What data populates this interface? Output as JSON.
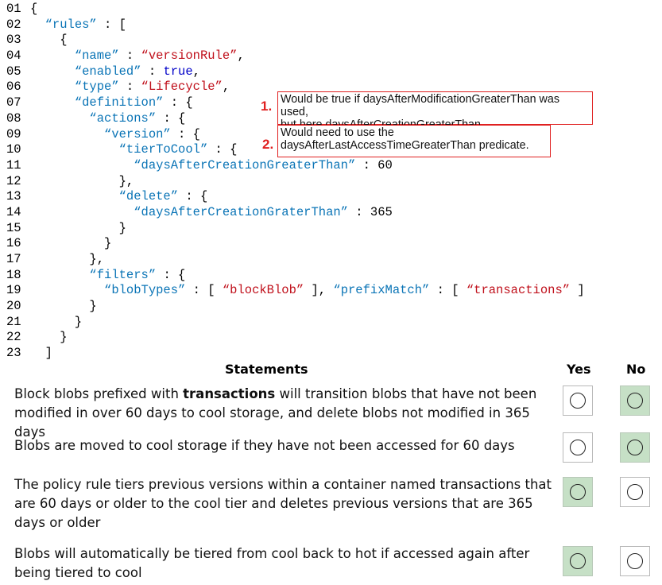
{
  "code_lines": [
    {
      "num": "01",
      "parts": [
        {
          "t": "{",
          "c": "p"
        }
      ]
    },
    {
      "num": "02",
      "parts": [
        {
          "t": "  ",
          "c": "p"
        },
        {
          "t": "“rules”",
          "c": "k"
        },
        {
          "t": " : [",
          "c": "p"
        }
      ]
    },
    {
      "num": "03",
      "parts": [
        {
          "t": "    {",
          "c": "p"
        }
      ]
    },
    {
      "num": "04",
      "parts": [
        {
          "t": "      ",
          "c": "p"
        },
        {
          "t": "“name”",
          "c": "k"
        },
        {
          "t": " : ",
          "c": "p"
        },
        {
          "t": "“versionRule”",
          "c": "s"
        },
        {
          "t": ",",
          "c": "p"
        }
      ]
    },
    {
      "num": "05",
      "parts": [
        {
          "t": "      ",
          "c": "p"
        },
        {
          "t": "“enabled”",
          "c": "k"
        },
        {
          "t": " : ",
          "c": "p"
        },
        {
          "t": "true",
          "c": "kw"
        },
        {
          "t": ",",
          "c": "p"
        }
      ]
    },
    {
      "num": "06",
      "parts": [
        {
          "t": "      ",
          "c": "p"
        },
        {
          "t": "“type”",
          "c": "k"
        },
        {
          "t": " : ",
          "c": "p"
        },
        {
          "t": "“Lifecycle”",
          "c": "s"
        },
        {
          "t": ",",
          "c": "p"
        }
      ]
    },
    {
      "num": "07",
      "parts": [
        {
          "t": "      ",
          "c": "p"
        },
        {
          "t": "“definition”",
          "c": "k"
        },
        {
          "t": " : {",
          "c": "p"
        }
      ]
    },
    {
      "num": "08",
      "parts": [
        {
          "t": "        ",
          "c": "p"
        },
        {
          "t": "“actions”",
          "c": "k"
        },
        {
          "t": " : {",
          "c": "p"
        }
      ]
    },
    {
      "num": "09",
      "parts": [
        {
          "t": "          ",
          "c": "p"
        },
        {
          "t": "“version”",
          "c": "k"
        },
        {
          "t": " : {",
          "c": "p"
        }
      ]
    },
    {
      "num": "10",
      "parts": [
        {
          "t": "            ",
          "c": "p"
        },
        {
          "t": "“tierToCool”",
          "c": "k"
        },
        {
          "t": " : {",
          "c": "p"
        }
      ]
    },
    {
      "num": "11",
      "parts": [
        {
          "t": "              ",
          "c": "p"
        },
        {
          "t": "“daysAfterCreationGreaterThan”",
          "c": "k"
        },
        {
          "t": " : 60",
          "c": "p"
        }
      ]
    },
    {
      "num": "12",
      "parts": [
        {
          "t": "            },",
          "c": "p"
        }
      ]
    },
    {
      "num": "13",
      "parts": [
        {
          "t": "            ",
          "c": "p"
        },
        {
          "t": "“delete”",
          "c": "k"
        },
        {
          "t": " : {",
          "c": "p"
        }
      ]
    },
    {
      "num": "14",
      "parts": [
        {
          "t": "              ",
          "c": "p"
        },
        {
          "t": "“daysAfterCreationGraterThan”",
          "c": "k"
        },
        {
          "t": " : 365",
          "c": "p"
        }
      ]
    },
    {
      "num": "15",
      "parts": [
        {
          "t": "            }",
          "c": "p"
        }
      ]
    },
    {
      "num": "16",
      "parts": [
        {
          "t": "          }",
          "c": "p"
        }
      ]
    },
    {
      "num": "17",
      "parts": [
        {
          "t": "        },",
          "c": "p"
        }
      ]
    },
    {
      "num": "18",
      "parts": [
        {
          "t": "        ",
          "c": "p"
        },
        {
          "t": "“filters”",
          "c": "k"
        },
        {
          "t": " : {",
          "c": "p"
        }
      ]
    },
    {
      "num": "19",
      "parts": [
        {
          "t": "          ",
          "c": "p"
        },
        {
          "t": "“blobTypes”",
          "c": "k"
        },
        {
          "t": " : [ ",
          "c": "p"
        },
        {
          "t": "“blockBlob”",
          "c": "s"
        },
        {
          "t": " ], ",
          "c": "p"
        },
        {
          "t": "“prefixMatch”",
          "c": "k"
        },
        {
          "t": " : [ ",
          "c": "p"
        },
        {
          "t": "“transactions”",
          "c": "s"
        },
        {
          "t": " ]",
          "c": "p"
        }
      ]
    },
    {
      "num": "20",
      "parts": [
        {
          "t": "        }",
          "c": "p"
        }
      ]
    },
    {
      "num": "21",
      "parts": [
        {
          "t": "      }",
          "c": "p"
        }
      ]
    },
    {
      "num": "22",
      "parts": [
        {
          "t": "    }",
          "c": "p"
        }
      ]
    },
    {
      "num": "23",
      "parts": [
        {
          "t": "  ]",
          "c": "p"
        }
      ]
    }
  ],
  "annotations": [
    {
      "number": "1.",
      "lines": [
        "Would be true if daysAfterModificationGreaterThan was used,",
        "but here daysAfterCreationGreaterThan"
      ]
    },
    {
      "number": "2.",
      "lines": [
        "Would need to use the",
        "daysAfterLastAccessTimeGreaterThan predicate."
      ]
    }
  ],
  "table": {
    "headers": {
      "statements": "Statements",
      "yes": "Yes",
      "no": "No"
    },
    "rows": [
      {
        "parts": [
          {
            "t": "Block blobs prefixed with "
          },
          {
            "t": "transactions",
            "b": true
          },
          {
            "t": " will transition blobs that have not been modified in over 60 days to cool storage, and delete blobs not modified in 365 days"
          }
        ],
        "answer": "No"
      },
      {
        "parts": [
          {
            "t": "Blobs are moved to cool storage if they have not been accessed for 60 days"
          }
        ],
        "answer": "No"
      },
      {
        "parts": [
          {
            "t": "The policy rule tiers previous versions within a container named transactions that are 60 days or older to the cool tier and deletes previous versions that are 365 days or older"
          }
        ],
        "answer": "Yes"
      },
      {
        "parts": [
          {
            "t": "Blobs will automatically be tiered from cool back to hot if accessed again after being tiered to cool"
          }
        ],
        "answer": "Yes"
      }
    ]
  }
}
